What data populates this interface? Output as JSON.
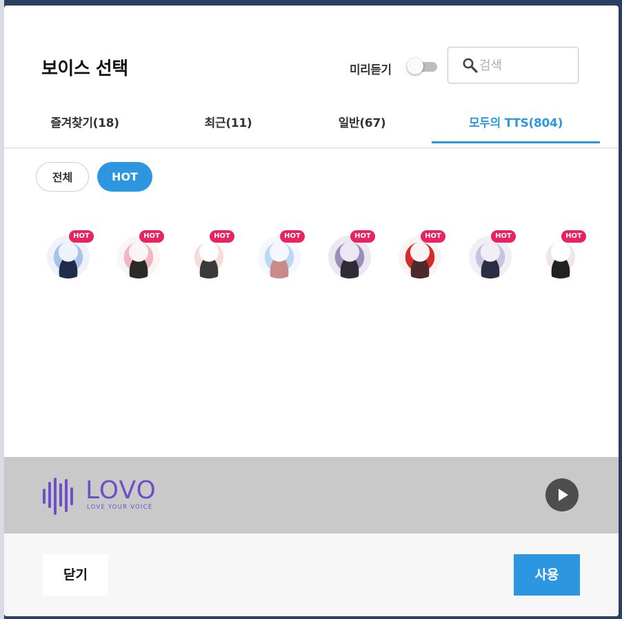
{
  "dialog": {
    "title": "보이스 선택",
    "preview_label": "미리듣기",
    "preview_enabled": false
  },
  "search": {
    "placeholder": "검색",
    "value": "",
    "icon": "search-icon"
  },
  "tabs": [
    {
      "label": "즐겨찾기(18)",
      "active": false
    },
    {
      "label": "최근(11)",
      "active": false
    },
    {
      "label": "일반(67)",
      "active": false
    },
    {
      "label": "모두의 TTS(804)",
      "active": true
    }
  ],
  "filters": [
    {
      "label": "전체",
      "active": false
    },
    {
      "label": "HOT",
      "active": true
    }
  ],
  "voices": [
    {
      "badge": "HOT",
      "colors": [
        "#eef3fb",
        "#aac4e8",
        "#1f2c4a"
      ]
    },
    {
      "badge": "HOT",
      "colors": [
        "#fbf4f4",
        "#f2b6c2",
        "#2a2a2a"
      ]
    },
    {
      "badge": "HOT",
      "colors": [
        "#ffffff",
        "#f3ddd6",
        "#3a3a3a"
      ]
    },
    {
      "badge": "HOT",
      "colors": [
        "#f4f8fd",
        "#bcd8f2",
        "#c98a8a"
      ]
    },
    {
      "badge": "HOT",
      "colors": [
        "#ece8f3",
        "#9a8fb6",
        "#2f2a36"
      ]
    },
    {
      "badge": "HOT",
      "colors": [
        "#fbf2f2",
        "#d42b2b",
        "#4a2a2a"
      ]
    },
    {
      "badge": "HOT",
      "colors": [
        "#f2eef6",
        "#c9c3e0",
        "#2b2e45"
      ]
    },
    {
      "badge": "HOT",
      "colors": [
        "#ffffff",
        "#f1e4ea",
        "#222222"
      ]
    }
  ],
  "provider": {
    "name": "LOVO",
    "tagline": "LOVE YOUR VOICE",
    "brand_color": "#6d50c8"
  },
  "actions": {
    "close_label": "닫기",
    "use_label": "사용"
  },
  "colors": {
    "accent": "#2d96e0",
    "hot_badge": "#e8235d",
    "provider_bar": "#c9c9c9"
  }
}
